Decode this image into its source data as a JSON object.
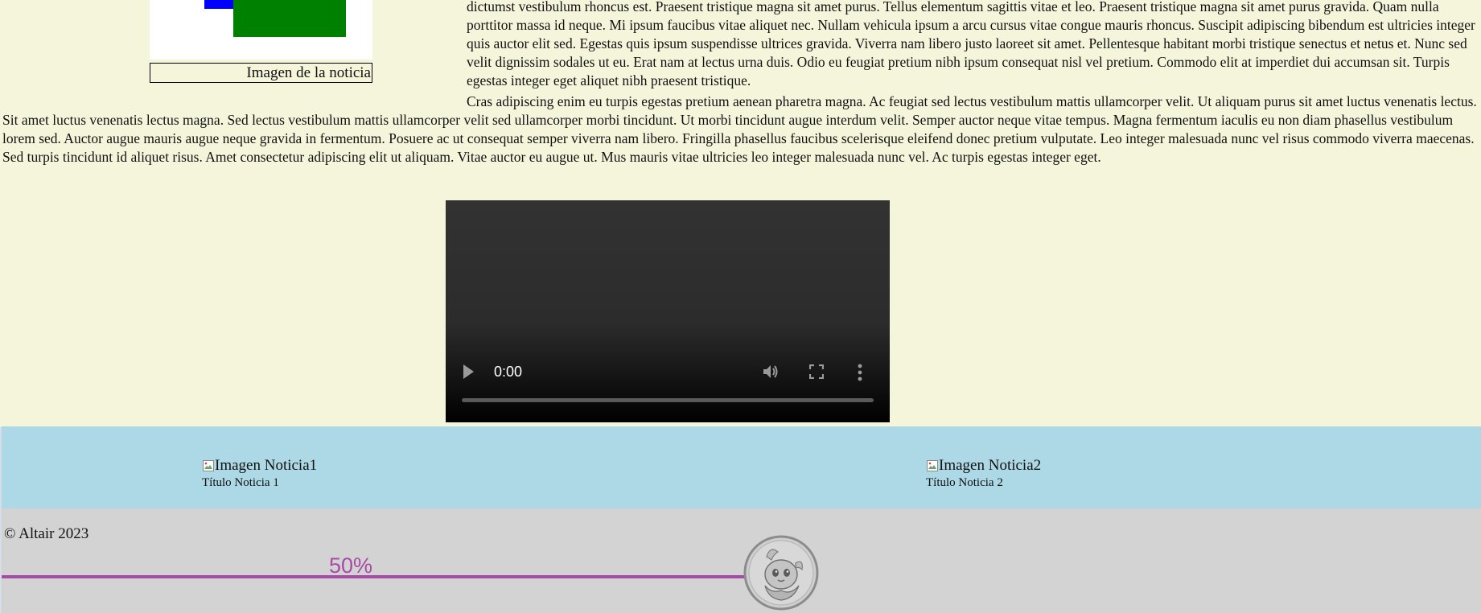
{
  "article": {
    "figure": {
      "caption": "Imagen de la noticia"
    },
    "paragraph_1": "dictumst vestibulum rhoncus est. Praesent tristique magna sit amet purus. Tellus elementum sagittis vitae et leo. Praesent tristique magna sit amet purus gravida. Quam nulla porttitor massa id neque. Mi ipsum faucibus vitae aliquet nec. Nullam vehicula ipsum a arcu cursus vitae congue mauris rhoncus. Suscipit adipiscing bibendum est ultricies integer quis auctor elit sed. Egestas quis ipsum suspendisse ultrices gravida. Viverra nam libero justo laoreet sit amet. Pellentesque habitant morbi tristique senectus et netus et. Nunc sed velit dignissim sodales ut eu. Erat nam at lectus urna duis. Odio eu feugiat pretium nibh ipsum consequat nisl vel pretium. Commodo elit at imperdiet dui accumsan sit. Turpis egestas integer eget aliquet nibh praesent tristique.",
    "paragraph_2": "Cras adipiscing enim eu turpis egestas pretium aenean pharetra magna. Ac feugiat sed lectus vestibulum mattis ullamcorper velit. Ut aliquam purus sit amet luctus venenatis lectus. Sit amet luctus venenatis lectus magna. Sed lectus vestibulum mattis ullamcorper velit sed ullamcorper morbi tincidunt. Ut morbi tincidunt augue interdum velit. Semper auctor neque vitae tempus. Magna fermentum iaculis eu non diam phasellus vestibulum lorem sed. Auctor augue mauris augue neque gravida in fermentum. Posuere ac ut consequat semper viverra nam libero. Fringilla phasellus faucibus scelerisque eleifend donec pretium vulputate. Leo integer malesuada nunc vel risus commodo viverra maecenas. Sed turpis tincidunt id aliquet risus. Amet consectetur adipiscing elit ut aliquam. Vitae auctor eu augue ut. Mus mauris vitae ultricies leo integer malesuada nunc vel. Ac turpis egestas integer eget."
  },
  "video": {
    "time": "0:00",
    "progress": 0,
    "icons": [
      "play-icon",
      "volume-icon",
      "fullscreen-icon",
      "more-options-icon"
    ]
  },
  "news": {
    "cards": [
      {
        "image_alt": "Imagen Noticia1",
        "title": "Título Noticia 1"
      },
      {
        "image_alt": "Imagen Noticia2",
        "title": "Título Noticia 2"
      }
    ]
  },
  "footer": {
    "copyright": "© Altair 2023",
    "scroll_progress_label": "50%",
    "scroll_progress": 0.5
  },
  "colors": {
    "article_background": "#f5f5dc",
    "news_background": "#add8e6",
    "footer_background": "#d3d3d3",
    "accent": "#a64ca6"
  }
}
